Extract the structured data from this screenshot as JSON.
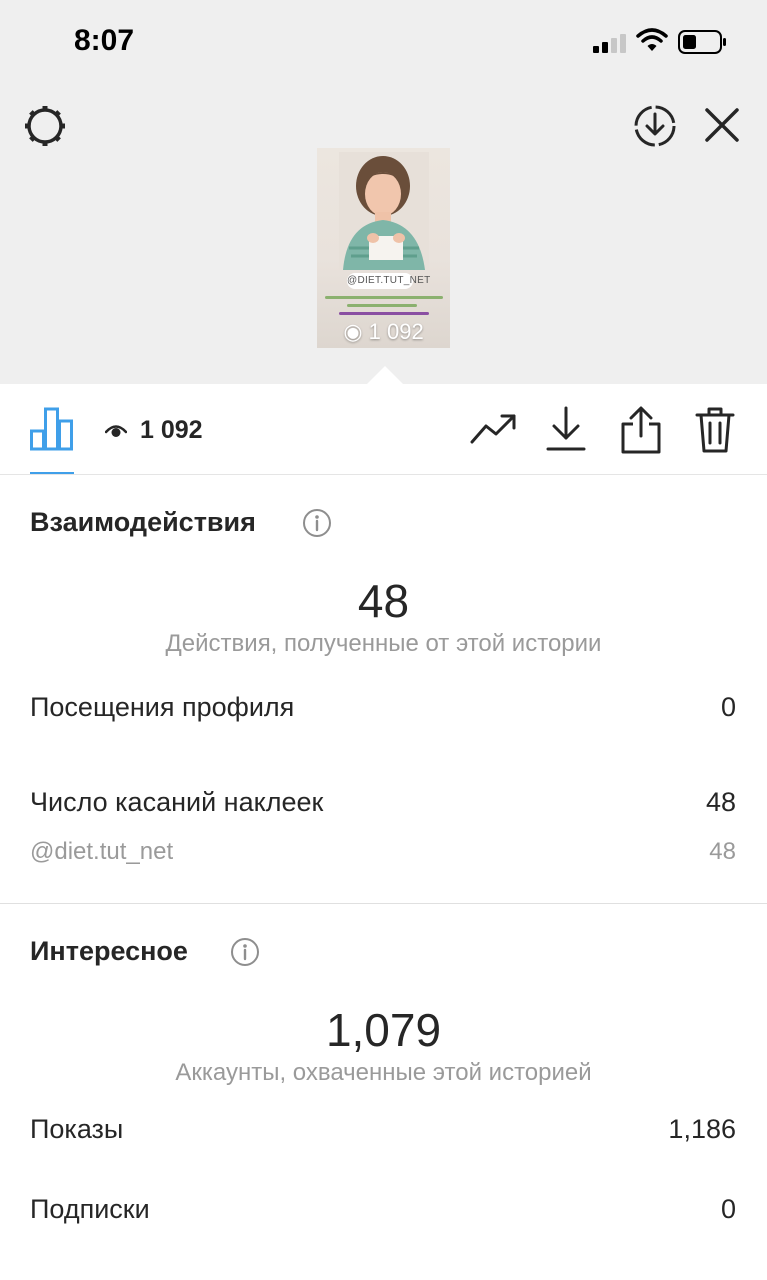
{
  "status_bar": {
    "time": "8:07"
  },
  "story_preview": {
    "sticker_tag": "@DIET.TUT_NET",
    "views": "1 092"
  },
  "toolbar": {
    "views": "1 092"
  },
  "interactions": {
    "title": "Взаимодействия",
    "total": "48",
    "caption": "Действия, полученные от этой истории",
    "rows": [
      {
        "label": "Посещения профиля",
        "value": "0"
      },
      {
        "label": "Число касаний наклеек",
        "value": "48"
      }
    ],
    "sub_rows": [
      {
        "label": "@diet.tut_net",
        "value": "48"
      }
    ]
  },
  "discovery": {
    "title": "Интересное",
    "total": "1,079",
    "caption": "Аккаунты, охваченные этой историей",
    "rows": [
      {
        "label": "Показы",
        "value": "1,186"
      },
      {
        "label": "Подписки",
        "value": "0"
      }
    ]
  },
  "colors": {
    "accent_blue": "#3f9fe9",
    "text_primary": "#262626",
    "text_secondary": "#9a9a9a",
    "top_background": "#efefef"
  },
  "icons": [
    "gear-icon",
    "download-circle-icon",
    "close-icon",
    "bar-chart-icon",
    "eye-icon",
    "trend-icon",
    "download-icon",
    "share-icon",
    "trash-icon",
    "info-icon"
  ]
}
